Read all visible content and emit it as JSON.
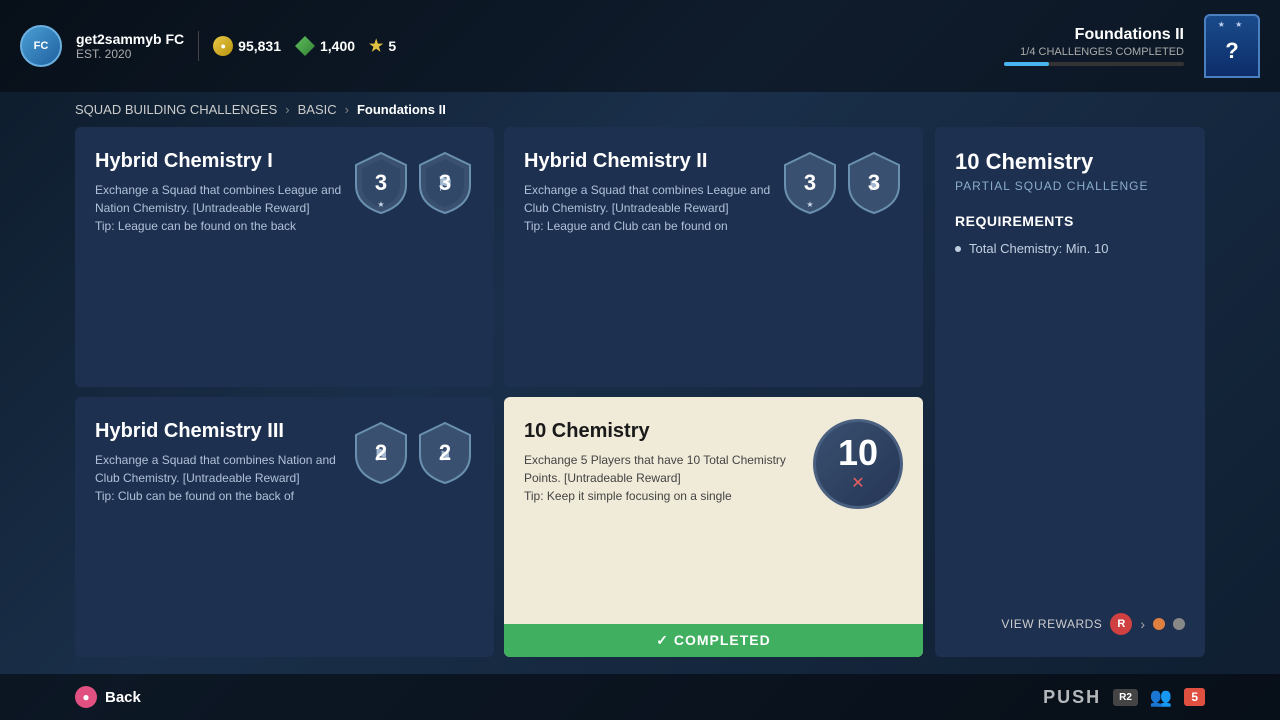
{
  "topbar": {
    "club_name": "get2sammyb FC",
    "est_label": "EST. 2020",
    "coins": "95,831",
    "points": "1,400",
    "stars": "5",
    "section_title": "Foundations II",
    "challenges_progress": "1/4 CHALLENGES COMPLETED",
    "help_symbol": "?"
  },
  "breadcrumb": {
    "item1": "SQUAD BUILDING CHALLENGES",
    "item2": "BASIC",
    "item3": "Foundations II"
  },
  "challenges": [
    {
      "id": "hybrid-chem-1",
      "title": "Hybrid Chemistry I",
      "description": "Exchange a Squad that combines League and Nation Chemistry. [Untradeable Reward]",
      "tip": "Tip: League can be found on the back",
      "badge_numbers": [
        "3",
        "3"
      ],
      "selected": false,
      "completed": false
    },
    {
      "id": "hybrid-chem-2",
      "title": "Hybrid Chemistry II",
      "description": "Exchange a Squad that combines League and Club Chemistry. [Untradeable Reward]",
      "tip": "Tip: League and Club can be found on",
      "badge_numbers": [
        "3",
        "3"
      ],
      "selected": false,
      "completed": false
    },
    {
      "id": "hybrid-chem-3",
      "title": "Hybrid Chemistry III",
      "description": "Exchange a Squad that combines Nation and Club Chemistry. [Untradeable Reward]",
      "tip": "Tip: Club can be found on the back of",
      "badge_numbers": [
        "2",
        "2"
      ],
      "selected": false,
      "completed": false
    },
    {
      "id": "10-chemistry",
      "title": "10 Chemistry",
      "description": "Exchange 5 Players that have 10 Total Chemistry Points. [Untradeable Reward]",
      "tip": "Tip: Keep it simple focusing on a single",
      "badge_number_large": "10",
      "selected": true,
      "completed": true
    }
  ],
  "right_panel": {
    "title": "10 Chemistry",
    "subtitle": "PARTIAL SQUAD CHALLENGE",
    "requirements_title": "REQUIREMENTS",
    "requirements": [
      "Total Chemistry: Min. 10"
    ],
    "view_rewards_label": "VIEW REWARDS",
    "btn_r_label": "R",
    "completed_label": "✓  COMPLETED"
  },
  "bottom": {
    "back_label": "Back",
    "push_logo": "PUSH",
    "r2_label": "R2",
    "users_count": "5"
  }
}
